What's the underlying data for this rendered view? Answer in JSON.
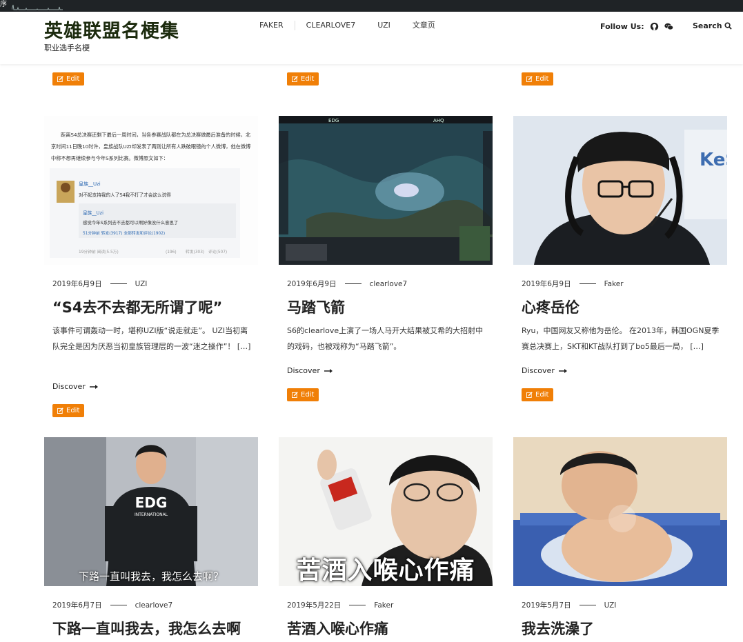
{
  "topbar": {
    "label": "序"
  },
  "site": {
    "title": "英雄联盟名梗集",
    "tagline": "职业选手名梗"
  },
  "nav": {
    "items": [
      "FAKER",
      "CLEARLOVE7",
      "UZI",
      "文章页"
    ]
  },
  "follow": {
    "label": "Follow Us:",
    "icons": [
      "github-icon",
      "wechat-icon"
    ]
  },
  "search": {
    "label": "Search"
  },
  "edit_label": "Edit",
  "discover_label": "Discover",
  "accent_color": "#f07f07",
  "posts": [
    {
      "date": "2019年6月9日",
      "author": "UZI",
      "title": "“S4去不去都无所谓了呢”",
      "excerpt": "该事件可谓轰动一时，堪称UZI版“说走就走”。 UZI当初离队完全是因为厌恶当初皇族管理层的一波“迷之操作”！ […]",
      "image": {
        "line1": "距离S4总决赛还剩下最后一周时间，当各参赛战队都在为总决赛做最后准备的时候，北",
        "line2": "京时间11日晚10时许，皇族战队UZI却发表了两则让所有人跌破眼镜的个人微博，他在微博",
        "line3": "中称不想再继续参与今年S系列比赛。微博原文如下：",
        "user1": "皇族__Uzi",
        "post1": "对不起支持我的人了S4我不打了才会这么说得",
        "user2": "皇族__Uzi",
        "post2": "感觉今年S系列去不去都可以啊好像没什么意思了",
        "stats": "51分钟前 转发(3917) 全部转发和评论(1902)",
        "footer": "19分钟前 阅读(5.5万)",
        "likes": "(196)",
        "reposts": "转发(303)",
        "comments": "评论(507)"
      }
    },
    {
      "date": "2019年6月9日",
      "author": "clearlove7",
      "title": "马踏飞箭",
      "excerpt": "S6的clearlove上演了一场人马开大结果被艾希的大招射中的戏码，也被戏称为“马踏飞箭”。",
      "image": {
        "tag_left": "EDG",
        "tag_right": "AHQ"
      }
    },
    {
      "date": "2019年6月9日",
      "author": "Faker",
      "title": "心疼岳伦",
      "excerpt": "Ryu，中国网友又称他为岳伦。 在2013年，韩国OGN夏季赛总决赛上，SKT和KT战队打到了bo5最后一局， […]",
      "image": {
        "sign": "KeS"
      }
    },
    {
      "date": "2019年6月7日",
      "author": "clearlove7",
      "title": "下路一直叫我去，我怎么去啊",
      "image": {
        "caption": "下路一直叫我去，我怎么去啊？",
        "jersey": "EDG",
        "jersey_sub": "INTERNATIONAL"
      }
    },
    {
      "date": "2019年5月22日",
      "author": "Faker",
      "title": "苦酒入喉心作痛",
      "image": {
        "caption": "苦酒入喉心作痛"
      }
    },
    {
      "date": "2019年5月7日",
      "author": "UZI",
      "title": "我去洗澡了"
    }
  ]
}
